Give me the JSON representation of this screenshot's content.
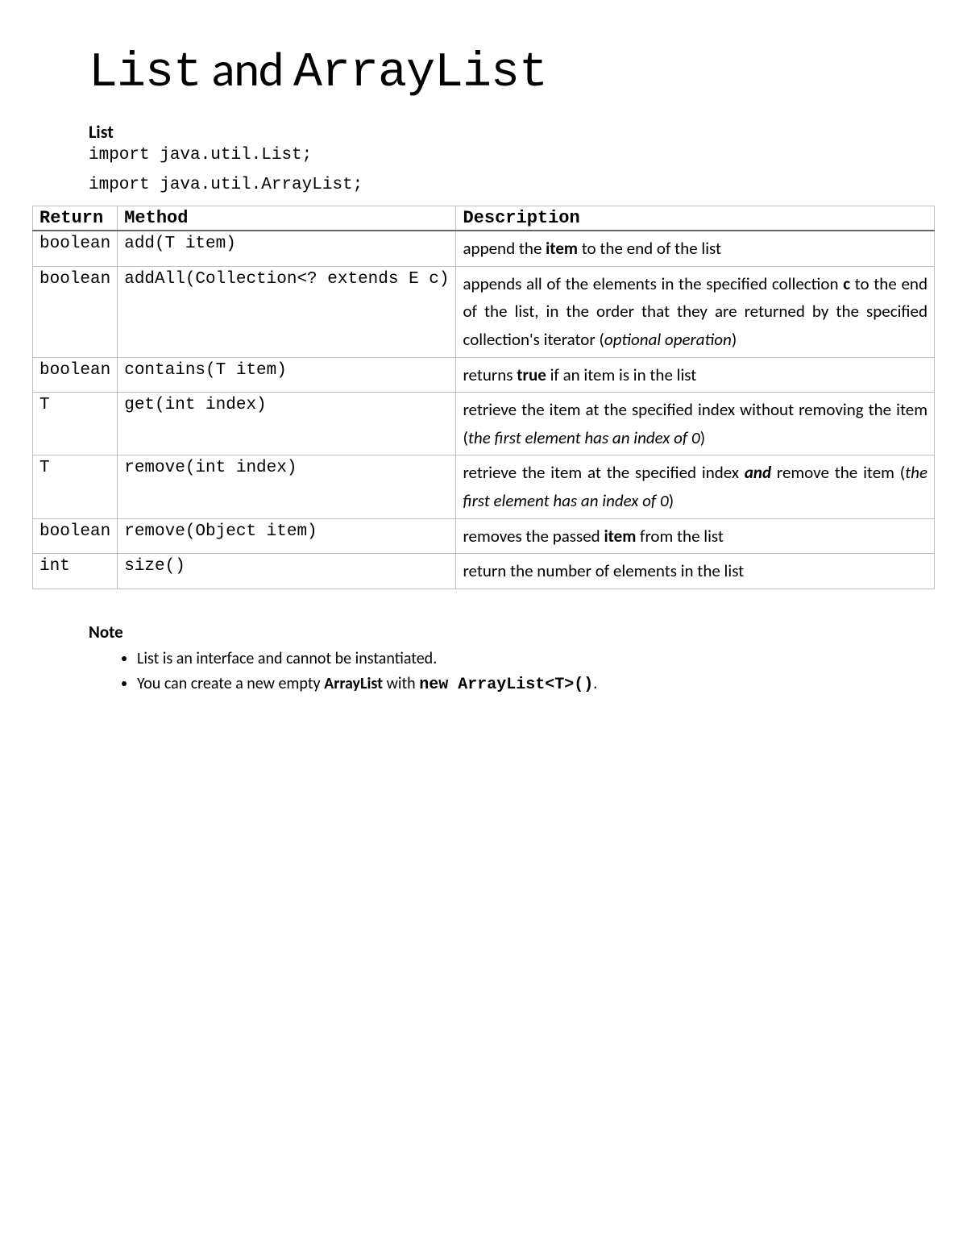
{
  "title": {
    "part1": "List",
    "part2": " and ",
    "part3": "ArrayList"
  },
  "section1_heading": "List",
  "imports": [
    "import java.util.List;",
    "import java.util.ArrayList;"
  ],
  "table": {
    "headers": {
      "col1": "Return",
      "col2": "Method",
      "col3": "Description"
    }
  },
  "rows": {
    "r0": {
      "ret": "boolean",
      "method": "add(T item)",
      "d_pre": "append the ",
      "d_b1": "item",
      "d_post": " to the end of the list"
    },
    "r1": {
      "ret": "boolean",
      "method": "addAll(Collection<? extends E c)",
      "d_pre": "appends all of the elements in the specified collection ",
      "d_b1": "c",
      "d_mid": " to the end of the list, in the order that they are returned by the specified collection's iterator (",
      "d_i1": "optional operation",
      "d_post": ")"
    },
    "r2": {
      "ret": "boolean",
      "method": "contains(T item)",
      "d_pre": "returns ",
      "d_b1": "true",
      "d_post": " if an item is in the list"
    },
    "r3": {
      "ret": "T",
      "method": "get(int index)",
      "d_pre": "retrieve the item at the specified index without removing the item (",
      "d_i1": "the first element has an index of 0",
      "d_post": ")"
    },
    "r4": {
      "ret": "T",
      "method": "remove(int index)",
      "d_pre": "retrieve the item at the specified index ",
      "d_bi1": "and",
      "d_mid": " remove the item (",
      "d_i1": "the first element has an index of 0",
      "d_post": ")"
    },
    "r5": {
      "ret": "boolean",
      "method": "remove(Object item)",
      "d_pre": "removes the passed ",
      "d_b1": "item",
      "d_post": " from the list"
    },
    "r6": {
      "ret": "int",
      "method": "size()",
      "d_pre": "return the number of elements in the list"
    }
  },
  "note": {
    "heading": "Note",
    "n1": "List is an interface and cannot be instantiated.",
    "n2_pre": "You can create a new empty ",
    "n2_b1": "ArrayList",
    "n2_mid": " with ",
    "n2_b2": "new ArrayList<T>()",
    "n2_post": "."
  }
}
